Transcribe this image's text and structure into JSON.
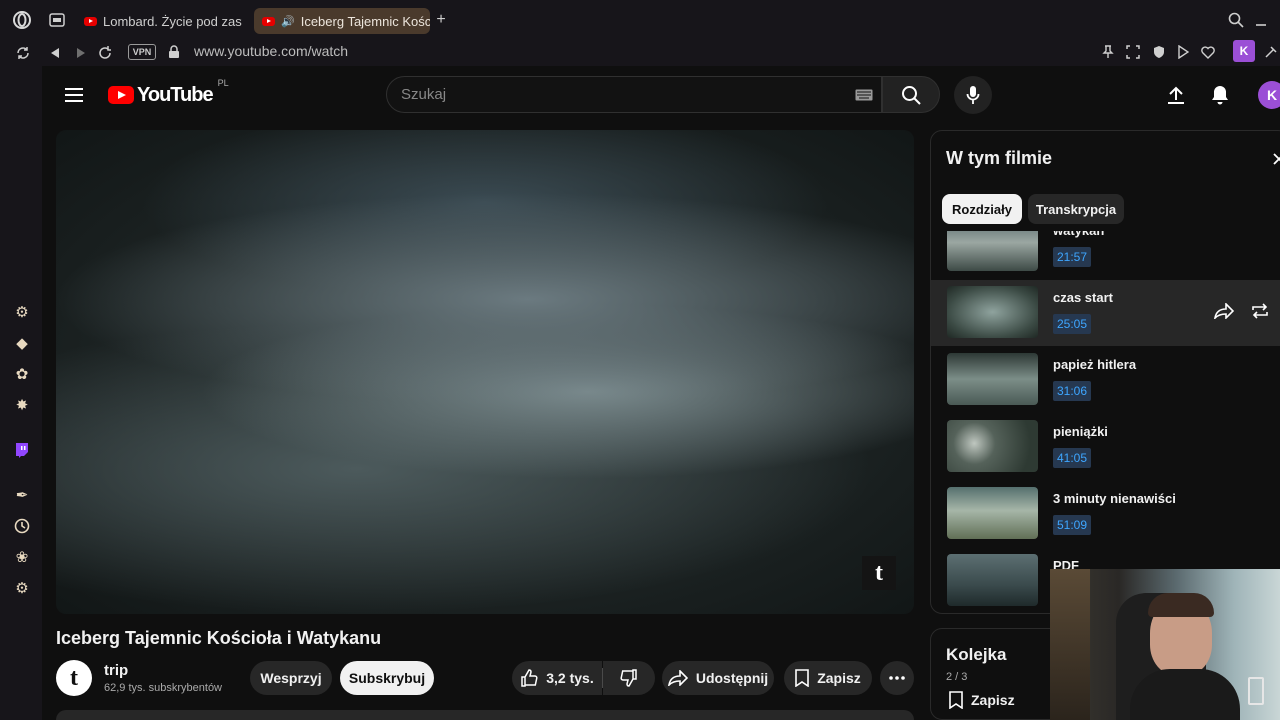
{
  "browser": {
    "tabs": [
      {
        "label": "Lombard. Życie pod zasta",
        "active": false
      },
      {
        "label": "Iceberg Tajemnic Kości",
        "active": true
      }
    ],
    "new_tab": "+",
    "vpn_label": "VPN",
    "url": "www.youtube.com/watch",
    "profile_initial": "K"
  },
  "youtube": {
    "logo_text": "YouTube",
    "country": "PL",
    "search_placeholder": "Szukaj",
    "avatar_initial": "K"
  },
  "video": {
    "title": "Iceberg Tajemnic Kościoła i Watykanu",
    "channel_name": "trip",
    "channel_avatar": "t",
    "subscribers": "62,9 tys. subskrybentów",
    "support_label": "Wesprzyj",
    "subscribe_label": "Subskrybuj",
    "likes": "3,2 tys.",
    "share_label": "Udostępnij",
    "save_label": "Zapisz",
    "watermark": "t"
  },
  "chapters_panel": {
    "title": "W tym filmie",
    "chips": [
      "Rozdziały",
      "Transkrypcja"
    ],
    "items": [
      {
        "title": "watykan",
        "time": "21:57",
        "active": false
      },
      {
        "title": "czas start",
        "time": "25:05",
        "active": true
      },
      {
        "title": "papież hitlera",
        "time": "31:06",
        "active": false
      },
      {
        "title": "pieniążki",
        "time": "41:05",
        "active": false
      },
      {
        "title": "3 minuty nienawiści",
        "time": "51:09",
        "active": false
      },
      {
        "title": "PDF",
        "time": "",
        "active": false
      }
    ]
  },
  "queue": {
    "title": "Kolejka",
    "position": "2 / 3",
    "save_label": "Zapisz"
  },
  "colors": {
    "accent_red": "#ff0000",
    "profile_purple": "#9b4fd6",
    "chapter_time_blue": "#3ea6ff"
  }
}
